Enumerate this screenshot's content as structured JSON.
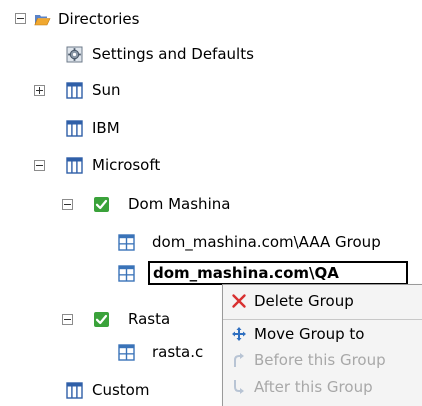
{
  "tree": {
    "root_label": "Directories",
    "settings_label": "Settings and Defaults",
    "sun_label": "Sun",
    "ibm_label": "IBM",
    "microsoft_label": "Microsoft",
    "dom_mashina_label": "Dom Mashina",
    "aaa_group_label": "dom_mashina.com\\AAA Group",
    "qa_editing_value": "dom_mashina.com\\QA",
    "rasta_label": "Rasta",
    "rasta_child_label": "rasta.c",
    "custom_label": "Custom"
  },
  "context_menu": {
    "delete_group": "Delete Group",
    "move_group_to": "Move Group to",
    "before_this_group": "Before this Group",
    "after_this_group": "After this Group"
  },
  "colors": {
    "folder": "#f0a830",
    "directory_icon": "#2f5fa8",
    "group_icon": "#3a73b8",
    "checkbox_green": "#3aa23a",
    "delete_red": "#d83030",
    "disabled_text": "#a8a8a8"
  },
  "icons": {
    "root": "folder-open-icon",
    "settings": "settings-icon",
    "directory": "directory-icon",
    "domain": "checked-domain-icon",
    "group": "group-icon",
    "delete": "delete-x-icon",
    "move": "move-arrows-icon",
    "before": "arrow-up-icon",
    "after": "arrow-down-icon"
  }
}
